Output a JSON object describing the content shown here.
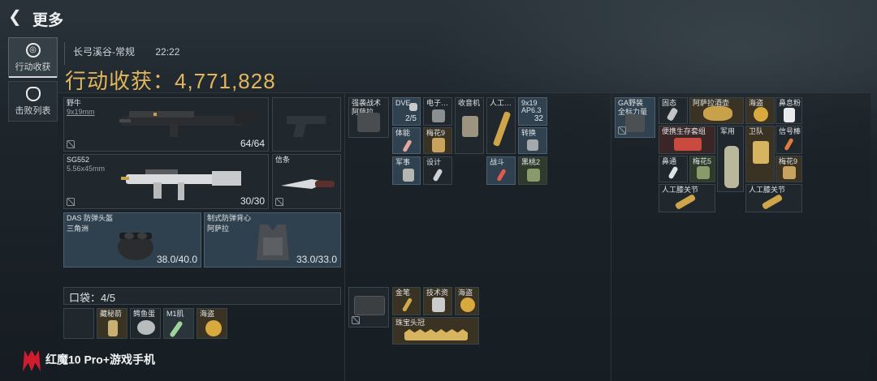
{
  "header": {
    "back_icon": "back-arrow-icon",
    "title": "更多"
  },
  "sidebar": {
    "items": [
      {
        "label": "行动收获",
        "icon": "target-icon",
        "active": true
      },
      {
        "label": "击败列表",
        "icon": "skull-icon",
        "active": false
      }
    ]
  },
  "summary": {
    "map": "长弓溪谷-常规",
    "time": "22:22",
    "title": "行动收获：4,771,828"
  },
  "loadout": {
    "primary": {
      "name": "野牛",
      "caliber": "9x19mm",
      "ammo": "64/64"
    },
    "secondary": {
      "name": "SG552",
      "caliber": "5.56x45mm",
      "ammo": "30/30"
    },
    "melee": {
      "name": "信条"
    },
    "helmet": {
      "name": "DAS 防弹头盔",
      "sub": "三角洲",
      "durability": "38.0/40.0"
    },
    "armor": {
      "name": "制式防弹背心",
      "sub": "阿萨拉",
      "durability": "33.0/33.0"
    },
    "pocket": {
      "label": "口袋：",
      "count": "4",
      "total": "/5"
    },
    "pocket_items": [
      "藏秘箭",
      "鳄鱼蛋",
      "M1肌",
      "海盗"
    ]
  },
  "backpack": {
    "items": [
      {
        "label": "强袭战术",
        "sub": "阿萨拉"
      },
      {
        "label": "DVE",
        "count": "2/5"
      },
      {
        "label": "电子…"
      },
      {
        "label": "收音机"
      },
      {
        "label": "人工…"
      },
      {
        "label": "9x19",
        "sub": "AP6.3",
        "count": "32"
      },
      {
        "label": "体能"
      },
      {
        "label": "梅花9"
      },
      {
        "label": "转换"
      },
      {
        "label": "军事"
      },
      {
        "label": "设计"
      },
      {
        "label": "战斗"
      },
      {
        "label": "黑桃2"
      }
    ],
    "box_items": [
      {
        "label": "金笔"
      },
      {
        "label": "技术资"
      },
      {
        "label": "海盗"
      },
      {
        "label": "珠宝头冠"
      }
    ]
  },
  "safebox": {
    "items": [
      {
        "label": "GA野装",
        "sub": "全标力量"
      },
      {
        "label": "固态"
      },
      {
        "label": "阿萨拉酒壶"
      },
      {
        "label": "海盗"
      },
      {
        "label": "鼻息粉"
      },
      {
        "label": "便携生存套组"
      },
      {
        "label": "军用"
      },
      {
        "label": "卫队"
      },
      {
        "label": "信号棒"
      },
      {
        "label": "鼻通"
      },
      {
        "label": "梅花5"
      },
      {
        "label": "梅花9"
      },
      {
        "label": "人工膝关节"
      },
      {
        "label": "人工膝关节"
      }
    ]
  },
  "watermark": {
    "text": "红魔10 Pro+游戏手机"
  },
  "colors": {
    "accent_gold": "#e3b65c",
    "item_blue": "#344656"
  }
}
